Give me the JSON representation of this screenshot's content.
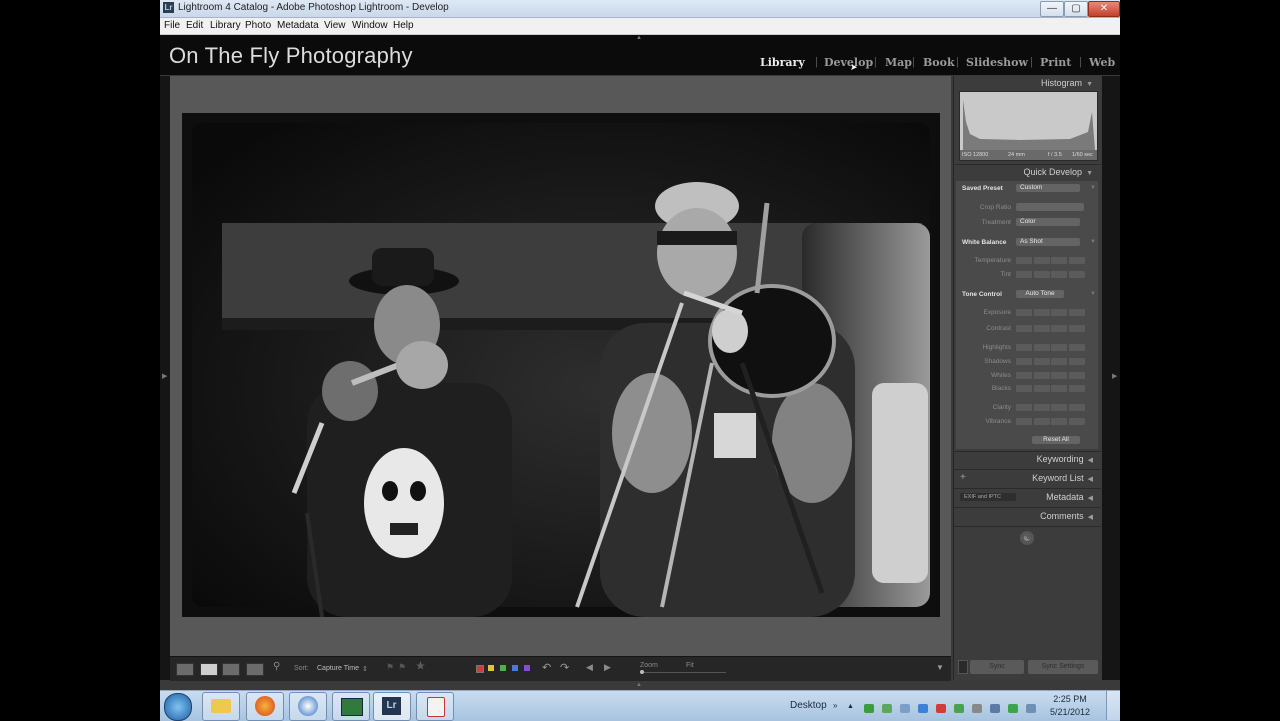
{
  "window": {
    "title": "Lightroom 4 Catalog - Adobe Photoshop Lightroom - Develop",
    "app_icon_label": "Lr",
    "min_glyph": "—",
    "max_glyph": "▢",
    "close_glyph": "✕"
  },
  "menu": [
    "File",
    "Edit",
    "Library",
    "Photo",
    "Metadata",
    "View",
    "Window",
    "Help"
  ],
  "identity_plate": "On The Fly Photography",
  "modules": [
    "Library",
    "Develop",
    "Map",
    "Book",
    "Slideshow",
    "Print",
    "Web"
  ],
  "active_module": "Library",
  "toolbar": {
    "sort_label": "Sort:",
    "sort_value": "Capture Time",
    "rating": "★★★★★",
    "rating_filled": 2,
    "zoom_label": "Zoom",
    "fit_label": "Fit",
    "color_labels": [
      "#d23b3b",
      "#d9c83a",
      "#4fb04a",
      "#4a7ad6",
      "#8a4ad6"
    ]
  },
  "histogram": {
    "title": "Histogram",
    "iso": "ISO 12800",
    "focal": "24 mm",
    "aperture": "f / 3.5",
    "shutter": "1/60 sec"
  },
  "quick_develop": {
    "title": "Quick Develop",
    "saved_preset_label": "Saved Preset",
    "saved_preset_value": "Custom",
    "crop_ratio_label": "Crop Ratio",
    "treatment_label": "Treatment",
    "treatment_value": "Color",
    "white_balance_label": "White Balance",
    "white_balance_value": "As Shot",
    "temperature_label": "Temperature",
    "tint_label": "Tint",
    "tone_control_label": "Tone Control",
    "auto_tone_label": "Auto Tone",
    "exposure_label": "Exposure",
    "contrast_label": "Contrast",
    "highlights_label": "Highlights",
    "shadows_label": "Shadows",
    "whites_label": "Whites",
    "blacks_label": "Blacks",
    "clarity_label": "Clarity",
    "vibrance_label": "Vibrance",
    "reset_all_label": "Reset All"
  },
  "panels": {
    "keywording": "Keywording",
    "keyword_list": "Keyword List",
    "metadata": "Metadata",
    "metadata_preset": "EXIF and IPTC",
    "comments": "Comments",
    "add_glyph": "+"
  },
  "sync": {
    "sync_label": "Sync",
    "sync_settings_label": "Sync Settings"
  },
  "taskbar": {
    "desktop_label": "Desktop",
    "time": "2:25 PM",
    "date": "5/21/2012",
    "lr_label": "Lr"
  }
}
